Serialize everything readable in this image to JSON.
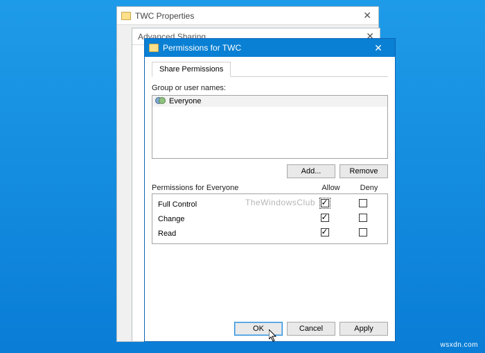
{
  "bg_window": {
    "title": "TWC Properties"
  },
  "adv_window": {
    "title": "Advanced Sharing"
  },
  "perm_window": {
    "title": "Permissions for TWC",
    "tab_label": "Share Permissions",
    "group_label": "Group or user names:",
    "user": "Everyone",
    "add_btn": "Add...",
    "remove_btn": "Remove",
    "perm_for_label": "Permissions for Everyone",
    "col_allow": "Allow",
    "col_deny": "Deny",
    "rows": {
      "0": {
        "name": "Full Control",
        "allow": true,
        "deny": false,
        "focus": true
      },
      "1": {
        "name": "Change",
        "allow": true,
        "deny": false
      },
      "2": {
        "name": "Read",
        "allow": true,
        "deny": false
      }
    },
    "ok_btn": "OK",
    "cancel_btn": "Cancel",
    "apply_btn": "Apply"
  },
  "watermark": "TheWindowsClub"
}
